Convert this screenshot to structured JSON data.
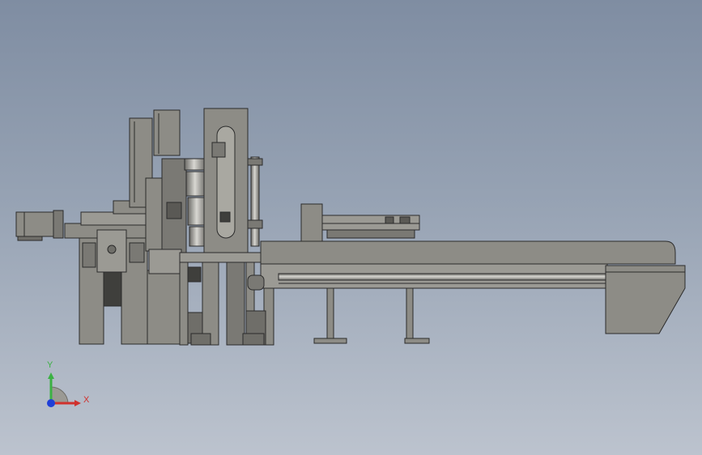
{
  "viewport": {
    "background_top": "#7f8da2",
    "background_bottom": "#bcc3ce"
  },
  "model": {
    "body_color": "#8d8c86",
    "shade_color": "#6f6e69",
    "light_color": "#a9a8a1",
    "edge_color": "#2b2b2b"
  },
  "triad": {
    "x_label": "X",
    "y_label": "Y",
    "x_color": "#d0312d",
    "y_color": "#3bb143",
    "z_color": "#1f3fd8"
  }
}
